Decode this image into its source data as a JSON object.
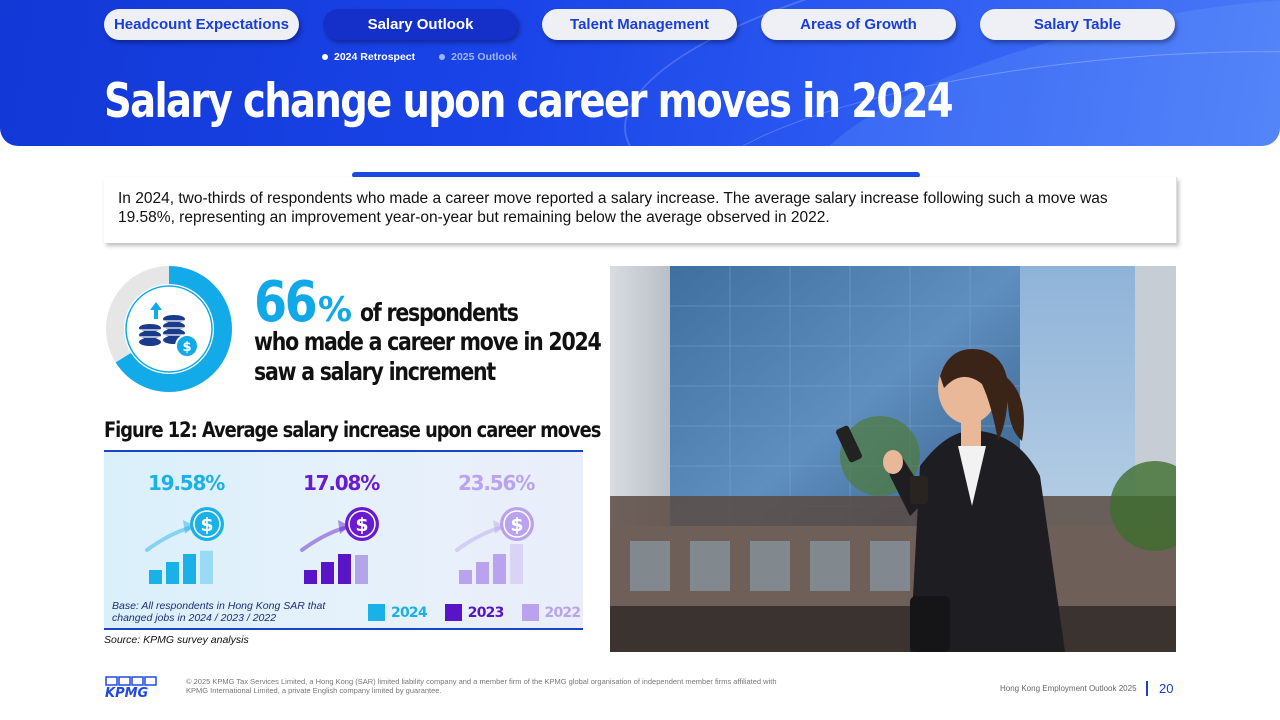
{
  "nav": {
    "tabs": [
      {
        "label": "Headcount Expectations",
        "active": false
      },
      {
        "label": "Salary Outlook",
        "active": true
      },
      {
        "label": "Talent Management",
        "active": false
      },
      {
        "label": "Areas of Growth",
        "active": false
      },
      {
        "label": "Salary Table",
        "active": false
      }
    ],
    "subtabs": [
      {
        "label": "2024 Retrospect",
        "active": true
      },
      {
        "label": "2025 Outlook",
        "active": false
      }
    ]
  },
  "title": "Salary change upon career moves in 2024",
  "summary": "In 2024, two-thirds of respondents who made a career move reported a salary increase. The average salary increase following such a move was 19.58%, representing an improvement year-on-year but remaining below the average observed in 2022.",
  "stat": {
    "value": "66",
    "unit": "%",
    "text_line1": "of respondents",
    "text_line2": "who made a career move in 2024",
    "text_line3": "saw a salary increment",
    "fraction": 0.66
  },
  "figure": {
    "title": "Figure 12: Average salary increase upon career moves",
    "base_note": "Base: All respondents in Hong Kong SAR that changed jobs in 2024 / 2023 / 2022",
    "source": "Source: KPMG survey analysis",
    "legend": [
      {
        "label": "2024",
        "color": "#1ab0e8"
      },
      {
        "label": "2023",
        "color": "#5a14c8"
      },
      {
        "label": "2022",
        "color": "#b9a3ee"
      }
    ]
  },
  "chart_data": {
    "type": "bar",
    "categories": [
      "2024",
      "2023",
      "2022"
    ],
    "values": [
      19.58,
      17.08,
      23.56
    ],
    "value_labels": [
      "19.58%",
      "17.08%",
      "23.56%"
    ],
    "colors": [
      "#1ab0e8",
      "#5a14c8",
      "#b9a3ee"
    ],
    "icon_colors": [
      "#1ab0e8",
      "#6a1ad0",
      "#b9a3ee"
    ]
  },
  "footer": {
    "logo": "KPMG",
    "legal": "© 2025 KPMG Tax Services Limited, a Hong Kong (SAR) limited liability company and a member firm of the KPMG global organisation of independent member firms affiliated with KPMG International Limited, a private English company limited by guarantee.",
    "report": "Hong Kong Employment Outlook 2025",
    "page": "20"
  },
  "icons": {
    "coins": "coins-dollar-icon",
    "growth": "growth-dollar-icon"
  }
}
